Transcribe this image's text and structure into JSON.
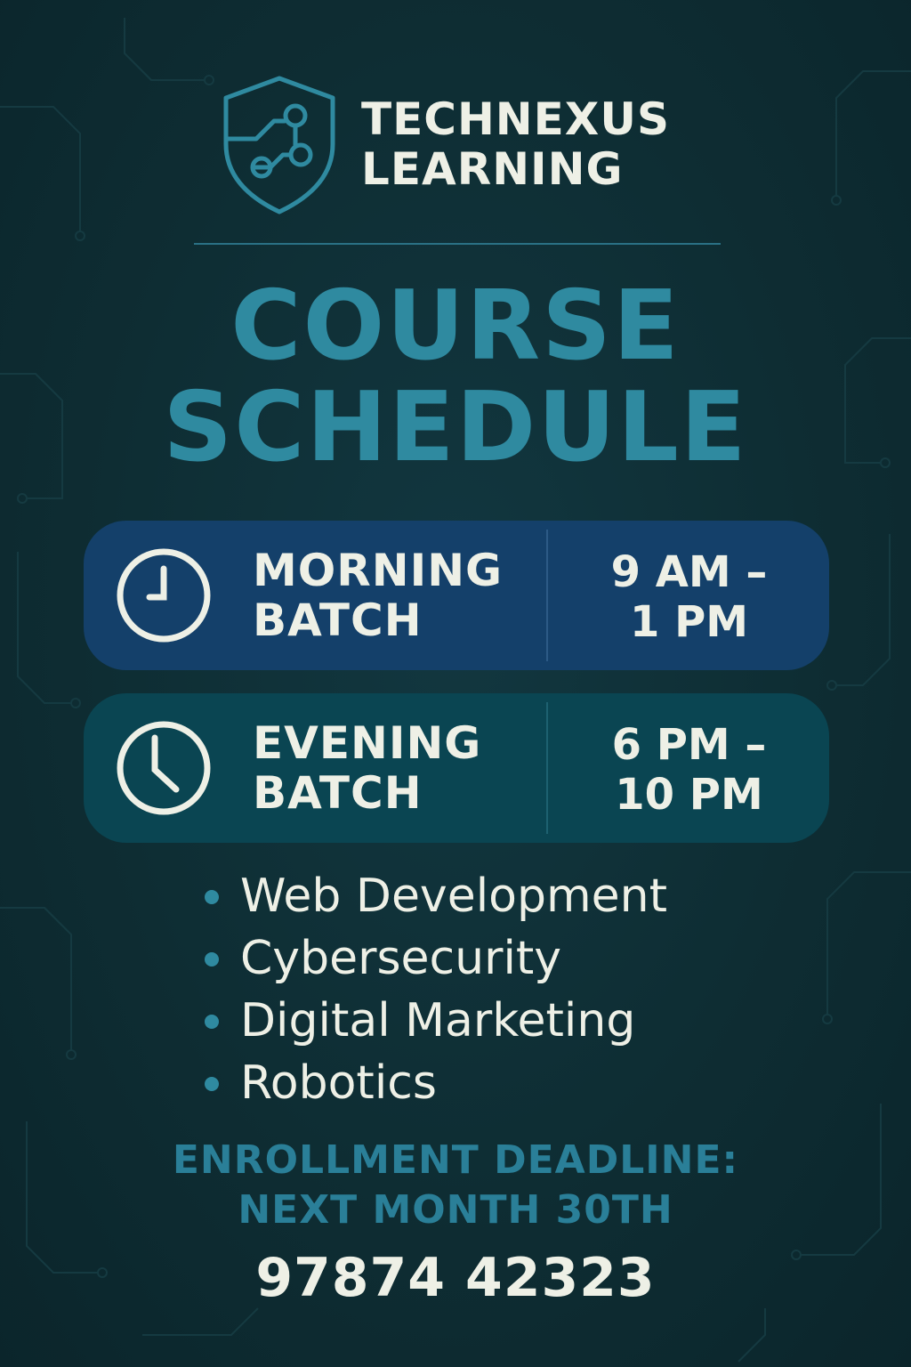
{
  "brand": {
    "name_line1": "TECHNEXUS",
    "name_line2": "LEARNING",
    "logo_icon": "shield-circuit-icon"
  },
  "title": {
    "line1": "COURSE",
    "line2": "SCHEDULE"
  },
  "batches": [
    {
      "name_line1": "MORNING",
      "name_line2": "BATCH",
      "time_line1": "9 AM –",
      "time_line2": "1 PM",
      "icon": "clock-icon"
    },
    {
      "name_line1": "EVENING",
      "name_line2": "BATCH",
      "time_line1": "6 PM –",
      "time_line2": "10 PM",
      "icon": "clock-icon"
    }
  ],
  "courses": [
    "Web Development",
    "Cybersecurity",
    "Digital Marketing",
    "Robotics"
  ],
  "deadline": {
    "line1": "ENROLLMENT DEADLINE:",
    "line2": "NEXT MONTH 30TH"
  },
  "phone": "97874 42323",
  "colors": {
    "background": "#0e2c32",
    "accent": "#2f8aa0",
    "text": "#eef0e6",
    "morning_panel": "#14406a",
    "evening_panel": "#0a4552"
  }
}
